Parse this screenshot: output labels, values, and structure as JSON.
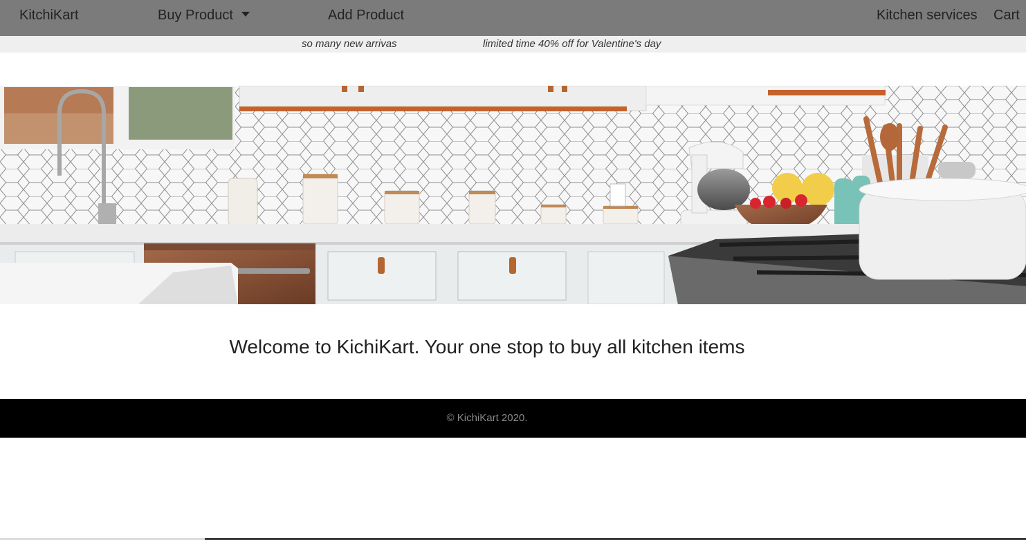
{
  "navbar": {
    "brand": "KitchiKart",
    "buy_product": "Buy Product",
    "add_product": "Add Product",
    "kitchen_services": "Kitchen services",
    "cart": "Cart",
    "background_color": "#7b7b7b"
  },
  "announcements": [
    "so many new arrivas",
    "limited time 40% off for Valentine's day"
  ],
  "hero": {
    "icon": "kitchen-photo"
  },
  "welcome": "Welcome to KichiKart. Your one stop to buy all kitchen items",
  "footer": {
    "copyright": "© KichiKart 2020.",
    "background_color": "#000000"
  }
}
